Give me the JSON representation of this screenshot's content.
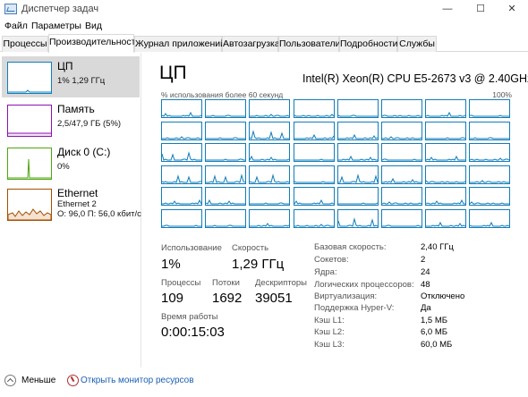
{
  "window": {
    "title": "Диспетчер задач",
    "minimize": "—",
    "maximize": "☐",
    "close": "✕"
  },
  "menu": [
    "Файл",
    "Параметры",
    "Вид"
  ],
  "tabs": [
    "Процессы",
    "Производительность",
    "Журнал приложений",
    "Автозагрузка",
    "Пользователи",
    "Подробности",
    "Службы"
  ],
  "active_tab": "Производительность",
  "sidebar": {
    "items": [
      {
        "title": "ЦП",
        "lines": [
          "1% 1,29 ГГц"
        ],
        "color": "#117dbb",
        "selected": true
      },
      {
        "title": "Память",
        "lines": [
          "2,5/47,9 ГБ (5%)"
        ],
        "color": "#8b12ae",
        "selected": false
      },
      {
        "title": "Диск 0 (C:)",
        "lines": [
          "0%"
        ],
        "color": "#4da60c",
        "selected": false
      },
      {
        "title": "Ethernet",
        "lines": [
          "Ethernet 2",
          "О: 96,0 П: 56,0 кбит/с"
        ],
        "color": "#a74f01",
        "selected": false
      }
    ]
  },
  "main": {
    "title": "ЦП",
    "cpu_name": "Intel(R) Xeon(R) CPU E5-2673 v3 @ 2.40GHz",
    "graph_label": "% использования более 60 секунд",
    "graph_max": "100%",
    "graph_color": "#117dbb",
    "logical_processors": 48
  },
  "stats": {
    "utilization": {
      "label": "Использование",
      "value": "1%"
    },
    "speed": {
      "label": "Скорость",
      "value": "1,29 ГГц"
    },
    "processes": {
      "label": "Процессы",
      "value": "109"
    },
    "threads": {
      "label": "Потоки",
      "value": "1692"
    },
    "handles": {
      "label": "Дескрипторы",
      "value": "39051"
    },
    "uptime": {
      "label": "Время работы",
      "value": "0:00:15:03"
    }
  },
  "specs": [
    {
      "label": "Базовая скорость:",
      "value": "2,40 ГГц"
    },
    {
      "label": "Сокетов:",
      "value": "2"
    },
    {
      "label": "Ядра:",
      "value": "24"
    },
    {
      "label": "Логических процессоров:",
      "value": "48"
    },
    {
      "label": "Виртуализация:",
      "value": "Отключено"
    },
    {
      "label": "Поддержка Hyper-V:",
      "value": "Да"
    },
    {
      "label": "Кэш L1:",
      "value": "1,5 МБ"
    },
    {
      "label": "Кэш L2:",
      "value": "6,0 МБ"
    },
    {
      "label": "Кэш L3:",
      "value": "60,0 МБ"
    }
  ],
  "footer": {
    "less": "Меньше",
    "monitor": "Открыть монитор ресурсов"
  }
}
